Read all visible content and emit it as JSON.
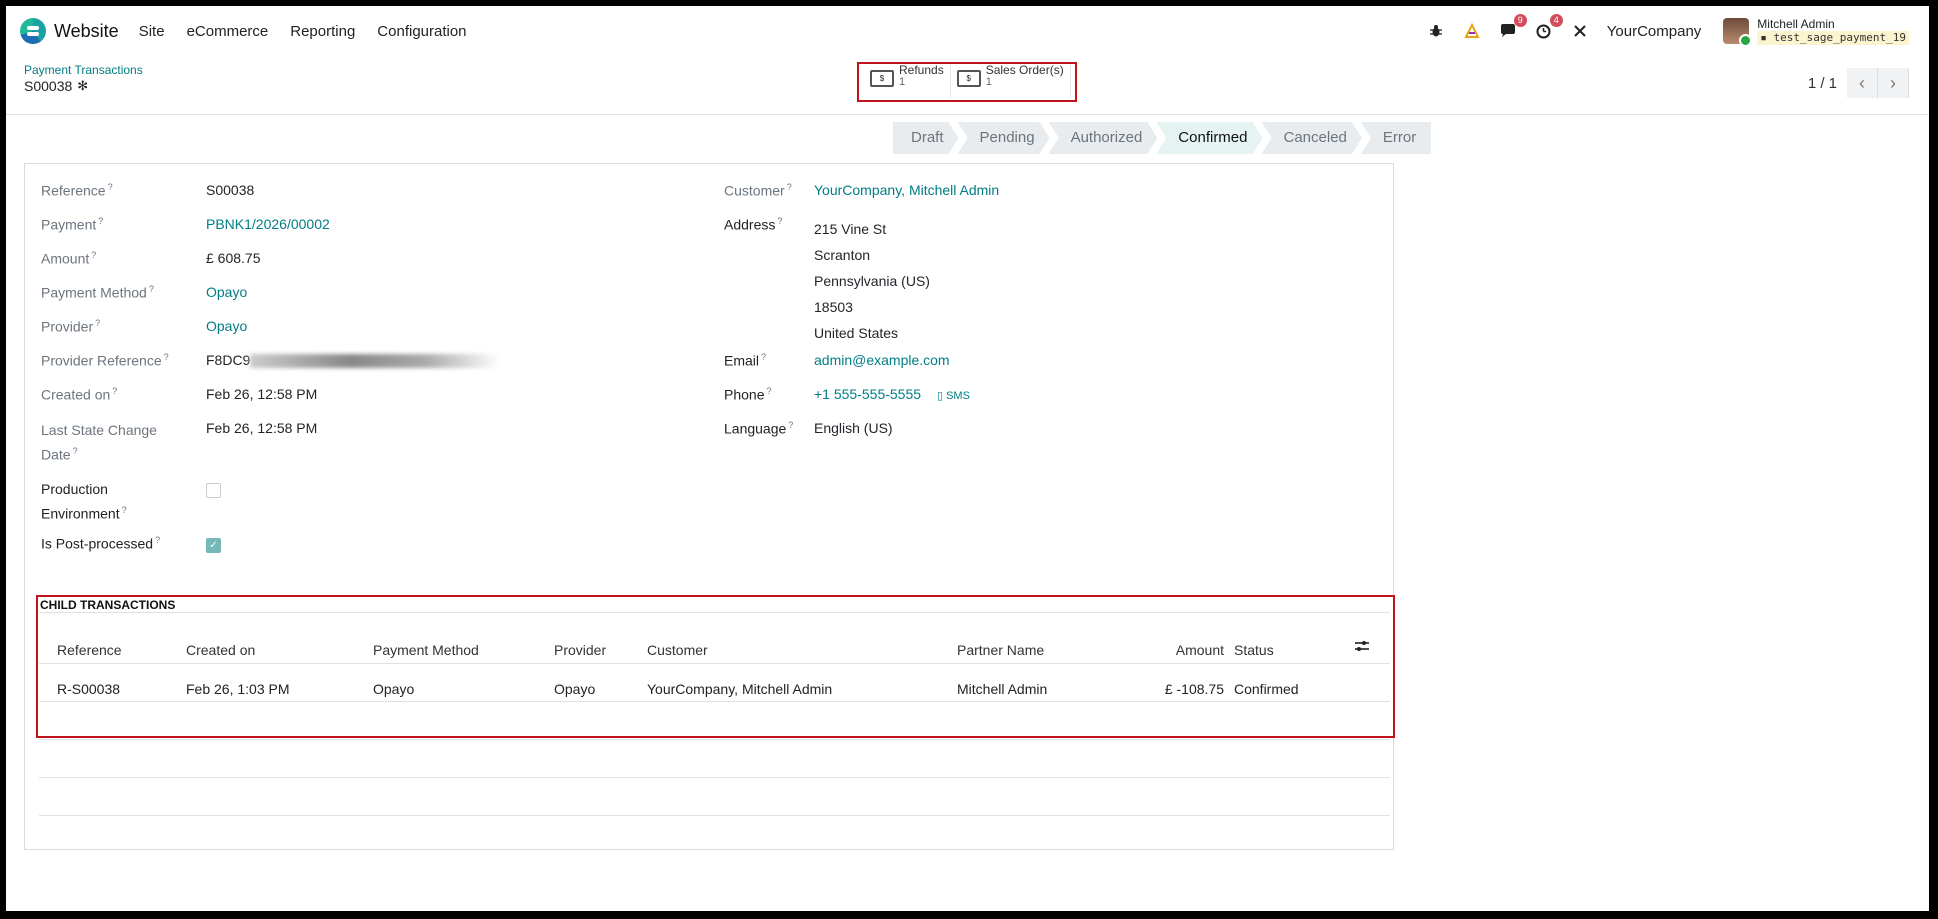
{
  "navbar": {
    "app_name": "Website",
    "menu": [
      "Site",
      "eCommerce",
      "Reporting",
      "Configuration"
    ],
    "messages_count": "9",
    "activities_count": "4",
    "company": "YourCompany",
    "user_name": "Mitchell Admin",
    "db_name": "test_sage_payment_19",
    "icons": [
      "bug-icon",
      "ai-icon",
      "chat-icon",
      "clock-icon",
      "tools-icon"
    ]
  },
  "control": {
    "breadcrumb": "Payment Transactions",
    "title": "S00038",
    "smart_buttons": [
      {
        "label": "Refunds",
        "count": "1"
      },
      {
        "label": "Sales Order(s)",
        "count": "1"
      }
    ],
    "pager": "1 / 1"
  },
  "statusbar": [
    "Draft",
    "Pending",
    "Authorized",
    "Confirmed",
    "Canceled",
    "Error"
  ],
  "statusbar_active": "Confirmed",
  "form": {
    "left": {
      "reference_label": "Reference",
      "reference": "S00038",
      "payment_label": "Payment",
      "payment": "PBNK1/2026/00002",
      "amount_label": "Amount",
      "amount": "£ 608.75",
      "payment_method_label": "Payment Method",
      "payment_method": "Opayo",
      "provider_label": "Provider",
      "provider": "Opayo",
      "provider_reference_label": "Provider Reference",
      "provider_reference": "F8DC9",
      "created_on_label": "Created on",
      "created_on": "Feb 26, 12:58 PM",
      "last_state_label_1": "Last State Change",
      "last_state_label_2": "Date",
      "last_state": "Feb 26, 12:58 PM",
      "production_label_1": "Production",
      "production_label_2": "Environment",
      "production": false,
      "post_processed_label": "Is Post-processed",
      "post_processed": true
    },
    "right": {
      "customer_label": "Customer",
      "customer": "YourCompany, Mitchell Admin",
      "address_label": "Address",
      "address": [
        "215 Vine St",
        "Scranton",
        "Pennsylvania (US)",
        "18503",
        "United States"
      ],
      "email_label": "Email",
      "email": "admin@example.com",
      "phone_label": "Phone",
      "phone": "+1 555-555-5555",
      "sms": "SMS",
      "language_label": "Language",
      "language": "English (US)"
    }
  },
  "child": {
    "title": "CHILD TRANSACTIONS",
    "headers": [
      "Reference",
      "Created on",
      "Payment Method",
      "Provider",
      "Customer",
      "Partner Name",
      "Amount",
      "Status"
    ],
    "rows": [
      [
        "R-S00038",
        "Feb 26, 1:03 PM",
        "Opayo",
        "Opayo",
        "YourCompany, Mitchell Admin",
        "Mitchell Admin",
        "£ -108.75",
        "Confirmed"
      ]
    ]
  }
}
